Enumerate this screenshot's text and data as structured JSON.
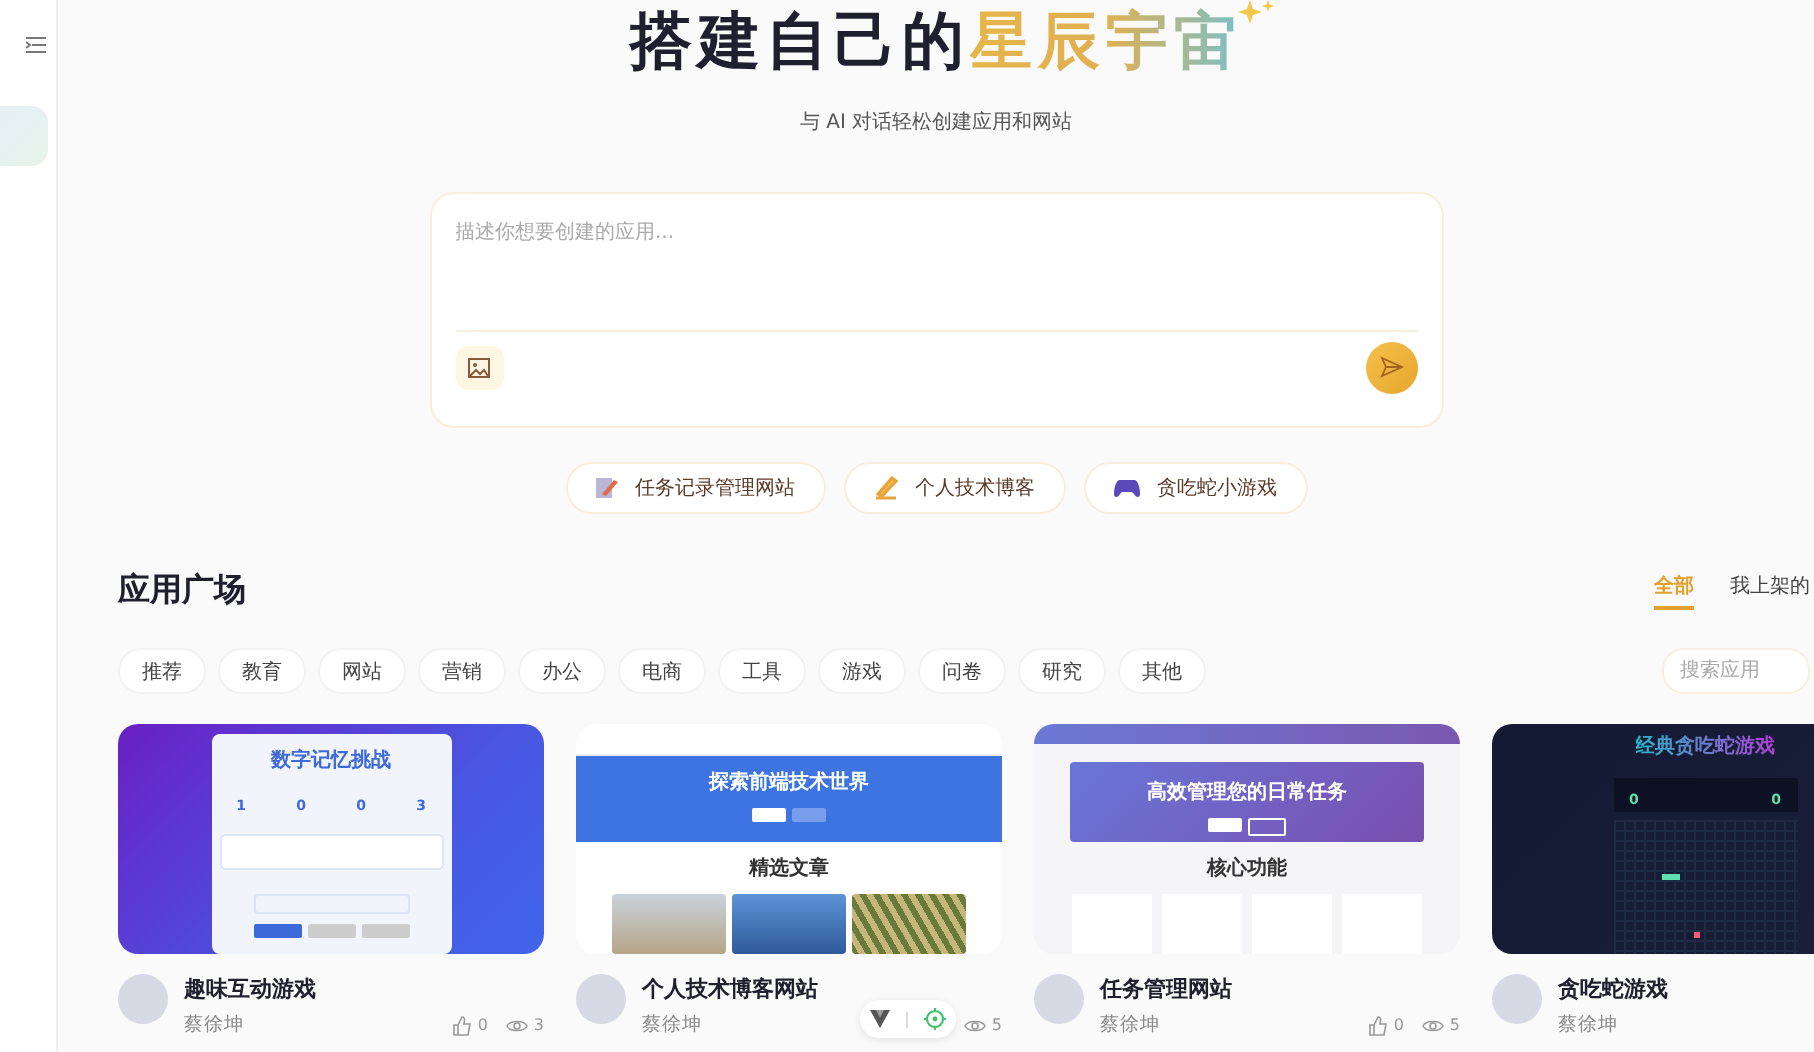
{
  "hero": {
    "title": "搭建自己的",
    "title_highlight": "星辰宇宙",
    "subtitle": "与 AI 对话轻松创建应用和网站"
  },
  "prompt": {
    "placeholder": "描述你想要创建的应用..."
  },
  "suggestions": [
    {
      "label": "任务记录管理网站",
      "kind": "memo"
    },
    {
      "label": "个人技术博客",
      "kind": "writing"
    },
    {
      "label": "贪吃蛇小游戏",
      "kind": "gamepad"
    }
  ],
  "gallery": {
    "title": "应用广场",
    "tabs": [
      {
        "label": "全部",
        "selected": true
      },
      {
        "label": "我上架的",
        "selected": false
      }
    ],
    "categories": [
      "推荐",
      "教育",
      "网站",
      "营销",
      "办公",
      "电商",
      "工具",
      "游戏",
      "问卷",
      "研究",
      "其他"
    ],
    "search": {
      "placeholder": "搜索应用"
    },
    "apps": [
      {
        "title": "趣味互动游戏",
        "author": "蔡徐坤",
        "likes": "0",
        "views": "3",
        "preview": {
          "kind": "memory",
          "heading": "数字记忆挑战",
          "numbers": [
            "1",
            "0",
            "0",
            "3"
          ]
        }
      },
      {
        "title": "个人技术博客网站",
        "author": "蔡徐坤",
        "views": "5",
        "preview": {
          "kind": "blog",
          "heading": "探索前端技术世界",
          "section": "精选文章"
        }
      },
      {
        "title": "任务管理网站",
        "author": "蔡徐坤",
        "likes": "0",
        "views": "5",
        "preview": {
          "kind": "tasks",
          "heading": "高效管理您的日常任务",
          "section": "核心功能"
        }
      },
      {
        "title": "贪吃蛇游戏",
        "author": "蔡徐坤",
        "preview": {
          "kind": "snake",
          "heading": "经典贪吃蛇游戏",
          "numbers": [
            "0",
            "0"
          ]
        }
      }
    ]
  }
}
